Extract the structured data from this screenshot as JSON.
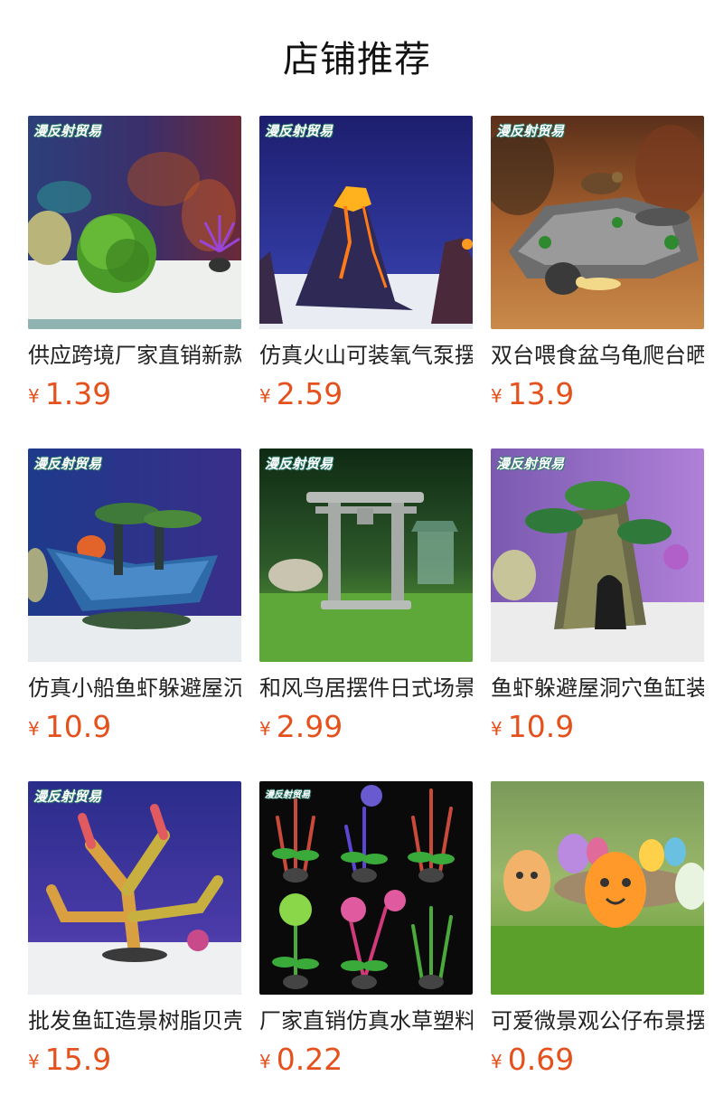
{
  "page": {
    "title": "店铺推荐"
  },
  "products": [
    {
      "name": "供应跨境厂家直销新款",
      "currency": "¥",
      "price": "1.39",
      "watermark": "漫反射贸易",
      "scene": "moss-ball"
    },
    {
      "name": "仿真火山可装氧气泵摆件",
      "currency": "¥",
      "price": "2.59",
      "watermark": "漫反射贸易",
      "scene": "volcano"
    },
    {
      "name": "双台喂食盆乌龟爬台晒台",
      "currency": "¥",
      "price": "13.9",
      "watermark": "漫反射贸易",
      "scene": "turtle-rock"
    },
    {
      "name": "仿真小船鱼虾躲避屋沉船",
      "currency": "¥",
      "price": "10.9",
      "watermark": "漫反射贸易",
      "scene": "shipwreck"
    },
    {
      "name": "和风鸟居摆件日式场景",
      "currency": "¥",
      "price": "2.99",
      "watermark": "漫反射贸易",
      "scene": "torii-gate"
    },
    {
      "name": "鱼虾躲避屋洞穴鱼缸装饰",
      "currency": "¥",
      "price": "10.9",
      "watermark": "漫反射贸易",
      "scene": "tree-cave"
    },
    {
      "name": "批发鱼缸造景树脂贝壳珊瑚",
      "currency": "¥",
      "price": "15.9",
      "watermark": "漫反射贸易",
      "scene": "coral"
    },
    {
      "name": "厂家直销仿真水草塑料",
      "currency": "¥",
      "price": "0.22",
      "watermark": "漫反射贸易",
      "scene": "water-plants"
    },
    {
      "name": "可爱微景观公仔布景摆件",
      "currency": "¥",
      "price": "0.69",
      "watermark": "",
      "scene": "cute-figures"
    }
  ],
  "colors": {
    "price": "#e5511d",
    "text": "#222222"
  }
}
